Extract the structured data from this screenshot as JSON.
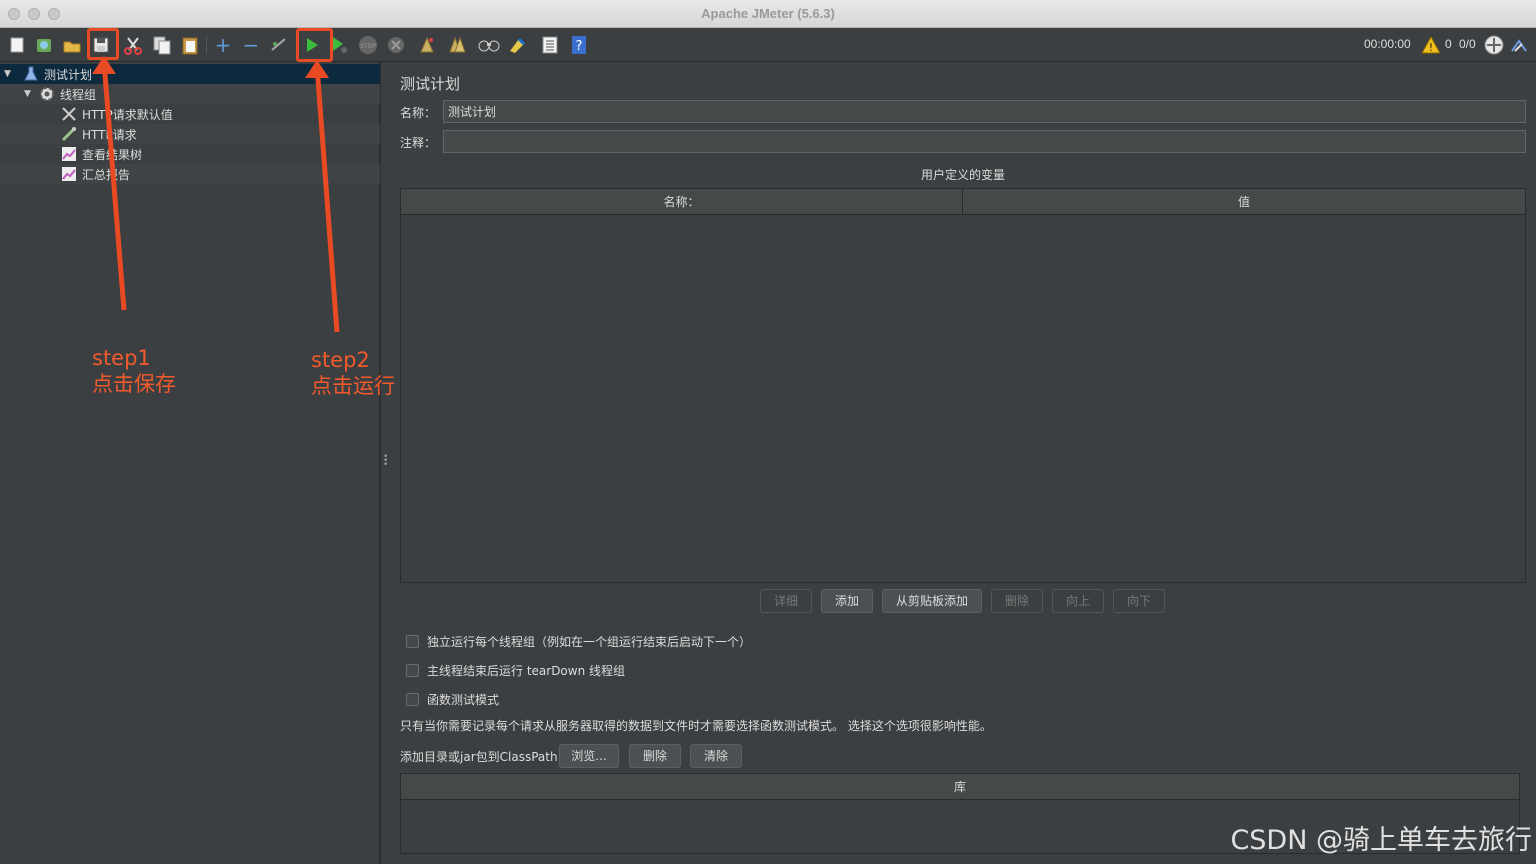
{
  "window": {
    "title": "Apache JMeter (5.6.3)"
  },
  "toolbar": {
    "timer": "00:00:00",
    "warning_count": "0",
    "thread_count": "0/0"
  },
  "tree": {
    "items": [
      {
        "label": "测试计划"
      },
      {
        "label": "线程组"
      },
      {
        "label": "HTTP请求默认值"
      },
      {
        "label": "HTTP请求"
      },
      {
        "label": "查看结果树"
      },
      {
        "label": "汇总报告"
      }
    ]
  },
  "test_plan": {
    "heading": "测试计划",
    "name_label": "名称：",
    "name_value": "测试计划",
    "comment_label": "注释：",
    "comment_value": "",
    "variables_title": "用户定义的变量",
    "columns": [
      "名称：",
      "值"
    ],
    "buttons": {
      "detail": "详细",
      "add": "添加",
      "add_clipboard": "从剪贴板添加",
      "delete": "删除",
      "up": "向上",
      "down": "向下"
    },
    "options": {
      "serialize": "独立运行每个线程组（例如在一个组运行结束后启动下一个）",
      "teardown": "主线程结束后运行 tearDown 线程组",
      "functional": "函数测试模式"
    },
    "functional_note": "只有当你需要记录每个请求从服务器取得的数据到文件时才需要选择函数测试模式。 选择这个选项很影响性能。",
    "classpath_label": "添加目录或jar包到ClassPath",
    "classpath_buttons": {
      "browse": "浏览...",
      "delete": "删除",
      "clear": "清除"
    },
    "library_column": "库"
  },
  "annotations": {
    "step1": {
      "line1": "step1",
      "line2": "点击保存"
    },
    "step2": {
      "line1": "step2",
      "line2": "点击运行"
    }
  },
  "watermark": "CSDN @骑上单车去旅行",
  "colors": {
    "annotation": "#f25a2c",
    "selection": "#0d293e"
  }
}
